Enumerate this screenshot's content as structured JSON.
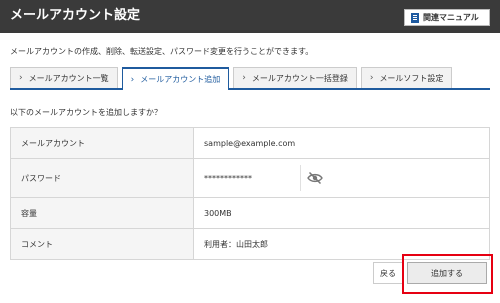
{
  "header": {
    "title": "メールアカウント設定",
    "manual_label": "関連マニュアル"
  },
  "description": "メールアカウントの作成、削除、転送設定、パスワード変更を行うことができます。",
  "tabs": [
    {
      "label": "メールアカウント一覧",
      "active": false
    },
    {
      "label": "メールアカウント追加",
      "active": true
    },
    {
      "label": "メールアカウント一括登録",
      "active": false
    },
    {
      "label": "メールソフト設定",
      "active": false
    }
  ],
  "confirm_text": "以下のメールアカウントを追加しますか？",
  "form": {
    "rows": [
      {
        "label": "メールアカウント",
        "value": "sample@example.com"
      },
      {
        "label": "パスワード",
        "value": "************"
      },
      {
        "label": "容量",
        "value": "300MB"
      },
      {
        "label": "コメント",
        "value": "利用者：山田太郎"
      }
    ]
  },
  "actions": {
    "back_label": "戻る",
    "submit_label": "追加する"
  },
  "colors": {
    "header_bg": "#3a3a3a",
    "accent": "#1f5b9e",
    "highlight": "#e60012"
  },
  "icons": {
    "manual": "book-icon",
    "tab": "chevron-right-icon",
    "password_toggle": "eye-slash-icon"
  }
}
